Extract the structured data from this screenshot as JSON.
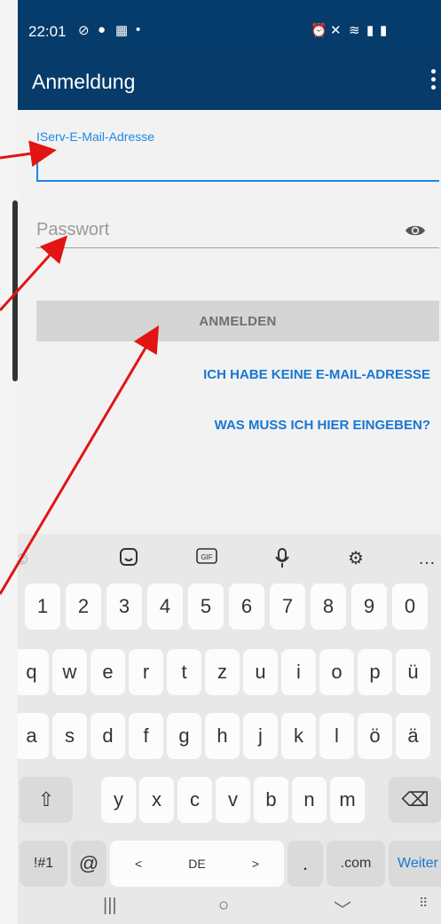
{
  "status_bar": {
    "time": "22:01",
    "left_icons": [
      "check-circle-icon",
      "alert-icon",
      "sim-icon",
      "dot-icon"
    ],
    "right_icons": [
      "alarm-icon",
      "mute-icon",
      "wifi-icon",
      "signal-icon",
      "battery-icon"
    ]
  },
  "app_bar": {
    "title": "Anmeldung",
    "menu_icon": "more-vert-icon",
    "color": "#063b6a"
  },
  "form": {
    "email_label": "IServ-E-Mail-Adresse",
    "email_value": "",
    "password_placeholder": "Passwort",
    "password_value": "",
    "login_button": "ANMELDEN",
    "no_email_link": "ICH HABE KEINE E-MAIL-ADRESSE",
    "help_link": "WAS MUSS ICH HIER EINGEBEN?",
    "accent_color": "#1e88e5"
  },
  "keyboard": {
    "toolbar": [
      "emoji-icon",
      "sticker-icon",
      "gif-icon",
      "microphone-icon",
      "settings-icon",
      "more-icon"
    ],
    "gif_label": "GIF",
    "more_label": "…",
    "row_numbers": [
      "1",
      "2",
      "3",
      "4",
      "5",
      "6",
      "7",
      "8",
      "9",
      "0"
    ],
    "row1": [
      "q",
      "w",
      "e",
      "r",
      "t",
      "z",
      "u",
      "i",
      "o",
      "p",
      "ü"
    ],
    "row2": [
      "a",
      "s",
      "d",
      "f",
      "g",
      "h",
      "j",
      "k",
      "l",
      "ö",
      "ä"
    ],
    "row3": [
      "y",
      "x",
      "c",
      "v",
      "b",
      "n",
      "m"
    ],
    "symbols_key": "!#1",
    "at_key": "@",
    "space_left": "<",
    "space_label": "DE",
    "space_right": ">",
    "period_key": ".",
    "com_key": ".com",
    "enter_key": "Weiter"
  },
  "nav_bar": {
    "recent_icon": "|||",
    "home_icon": "○",
    "back_icon": "﹀"
  }
}
